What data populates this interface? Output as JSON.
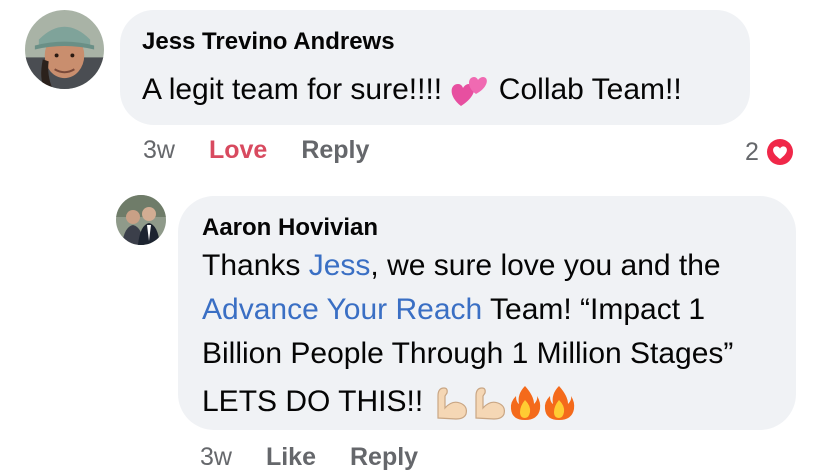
{
  "comment1": {
    "author": "Jess Trevino Andrews",
    "text_before": "A legit team for sure!!!! ",
    "emoji": "two-hearts",
    "text_after": " Collab Team!!",
    "time": "3w",
    "love_label": "Love",
    "reply_label": "Reply",
    "reaction_count": "2",
    "reaction_icon": "love-reaction-icon"
  },
  "comment2": {
    "author": "Aaron Hovivian",
    "line1_before": "Thanks ",
    "mention1": "Jess",
    "line1_after": ", we sure love you and the",
    "mention2": "Advance Your Reach",
    "line2_after": " Team! “Impact 1",
    "line3": "Billion People Through 1 Million Stages”",
    "line4": "LETS DO THIS!! ",
    "emojis": [
      "flexed-biceps",
      "flexed-biceps",
      "fire",
      "fire"
    ],
    "time": "3w",
    "like_label": "Like",
    "reply_label": "Reply"
  },
  "colors": {
    "bubble": "#f0f2f5",
    "mention": "#3a6fc4",
    "love": "#d84a5f",
    "meta": "#65676b"
  }
}
